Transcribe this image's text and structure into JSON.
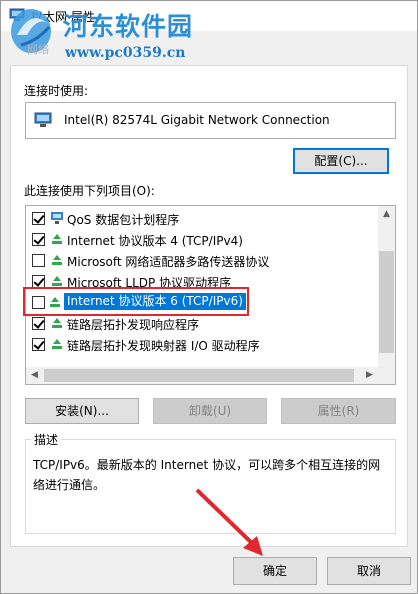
{
  "window": {
    "title": "以太网 属性",
    "tab": "网络"
  },
  "watermark": {
    "title": "河东软件园",
    "url": "www.pc0359.cn"
  },
  "connect_using": {
    "label": "连接时使用:",
    "adapter": "Intel(R) 82574L Gigabit Network Connection",
    "configure_button": "配置(C)..."
  },
  "items_section": {
    "label": "此连接使用下列项目(O):",
    "items": [
      {
        "label": "QoS 数据包计划程序",
        "checked": true,
        "icon": "qos-icon"
      },
      {
        "label": "Internet 协议版本 4 (TCP/IPv4)",
        "checked": true,
        "icon": "protocol-icon"
      },
      {
        "label": "Microsoft 网络适配器多路传送器协议",
        "checked": false,
        "icon": "protocol-icon"
      },
      {
        "label": "Microsoft LLDP 协议驱动程序",
        "checked": true,
        "icon": "protocol-icon"
      },
      {
        "label": "Internet 协议版本 6 (TCP/IPv6)",
        "checked": false,
        "selected": true,
        "icon": "protocol-icon"
      },
      {
        "label": "链路层拓扑发现响应程序",
        "checked": true,
        "icon": "protocol-icon"
      },
      {
        "label": "链路层拓扑发现映射器 I/O 驱动程序",
        "checked": true,
        "icon": "protocol-icon"
      }
    ]
  },
  "actions": {
    "install": "安装(N)...",
    "uninstall": "卸载(U)",
    "properties": "属性(R)"
  },
  "description": {
    "label": "描述",
    "text": "TCP/IPv6。最新版本的 Internet 协议，可以跨多个相互连接的网络进行通信。"
  },
  "footer": {
    "ok": "确定",
    "cancel": "取消"
  },
  "colors": {
    "accent": "#0078d7",
    "highlight_box": "#e0282e",
    "watermark": "#2a8fd8"
  }
}
